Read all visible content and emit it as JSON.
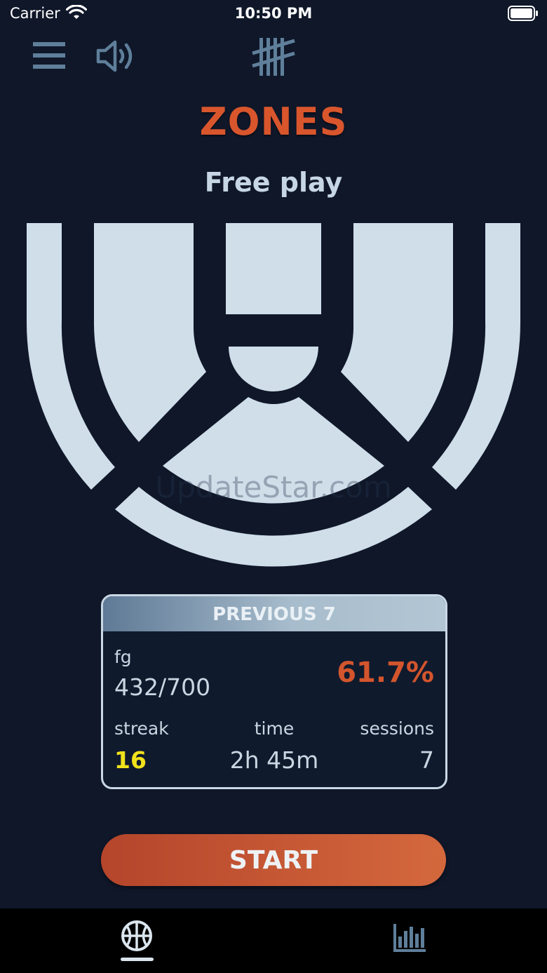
{
  "status_bar": {
    "carrier": "Carrier",
    "time": "10:50 PM"
  },
  "toolbar": {
    "icons": [
      "menu-icon",
      "speaker-icon",
      "tally-icon"
    ]
  },
  "header": {
    "title": "ZONES",
    "subtitle": "Free play"
  },
  "watermark": "UpdateStar.com",
  "stats_card": {
    "header": "PREVIOUS 7",
    "fg_label": "fg",
    "fg_value": "432/700",
    "fg_percent": "61.7%",
    "streak_label": "streak",
    "streak_value": "16",
    "time_label": "time",
    "time_value": "2h 45m",
    "sessions_label": "sessions",
    "sessions_value": "7"
  },
  "start_button": {
    "label": "START"
  },
  "tab_bar": {
    "tabs": [
      {
        "icon": "basketball-icon",
        "selected": true
      },
      {
        "icon": "bar-chart-icon",
        "selected": false
      }
    ]
  },
  "colors": {
    "background": "#0f1729",
    "accent": "#d9562d",
    "zone_fill": "#cfdee9",
    "streak": "#f1e21c"
  }
}
